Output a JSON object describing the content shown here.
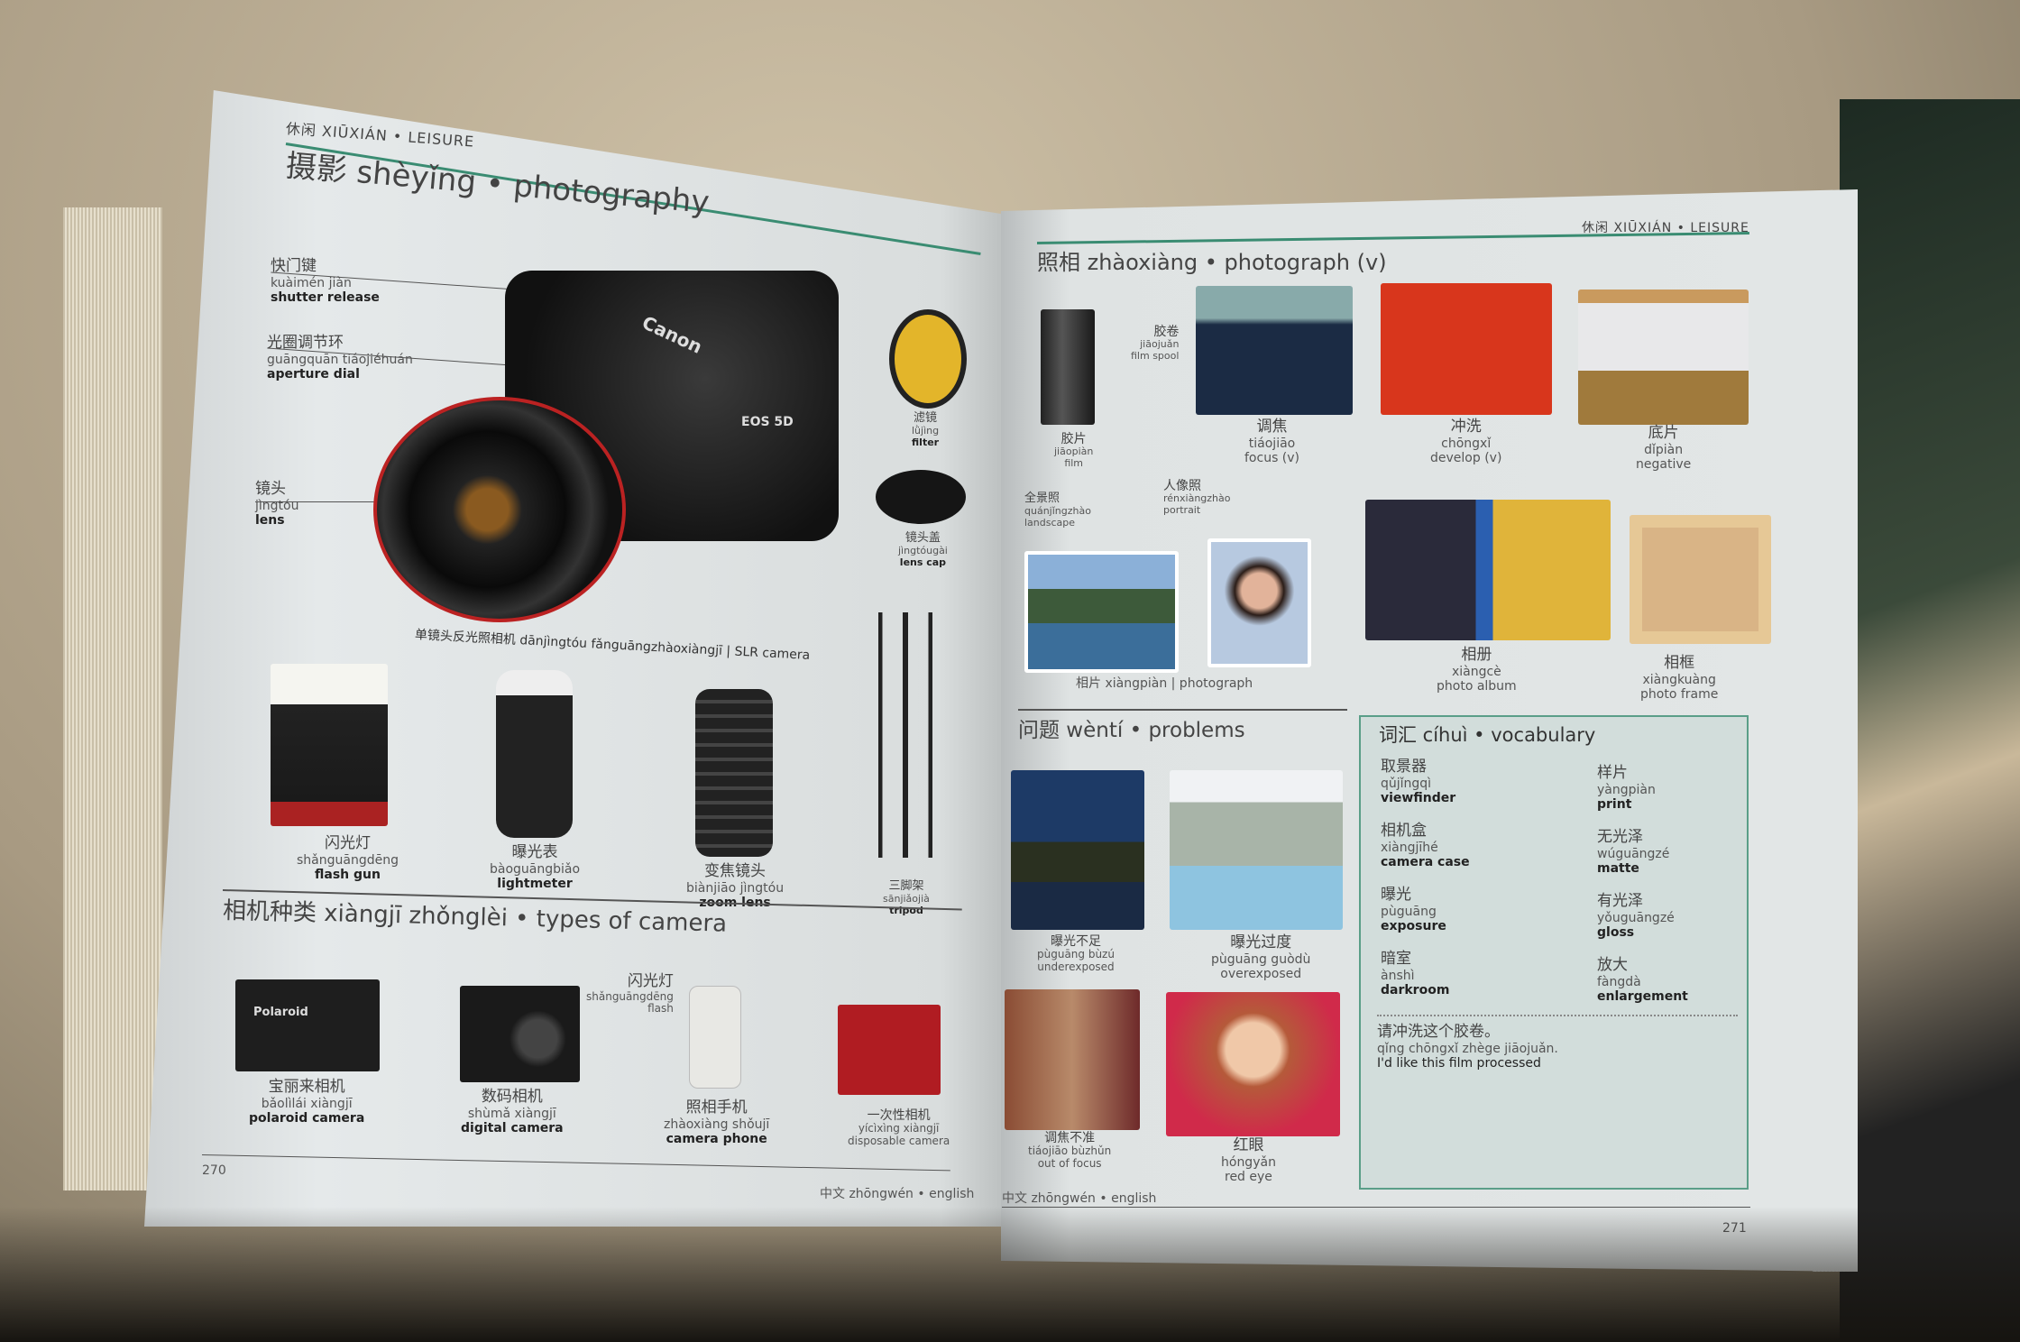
{
  "left_page": {
    "header": "休闲 XIŪXIÁN • LEISURE",
    "title": "摄影 shèyǐng • photography",
    "labels": [
      {
        "zh": "快门键",
        "py": "kuàimén jiàn",
        "en": "shutter release"
      },
      {
        "zh": "光圈调节环",
        "py": "guāngquān tiáojiéhuán",
        "en": "aperture dial"
      },
      {
        "zh": "镜头",
        "py": "jìngtóu",
        "en": "lens"
      },
      {
        "zh": "滤镜",
        "py": "lǜjìng",
        "en": "filter"
      },
      {
        "zh": "镜头盖",
        "py": "jìngtóugài",
        "en": "lens cap"
      }
    ],
    "slr_caption": "单镜头反光照相机 dānjìngtóu fǎnguāngzhàoxiàngjī | SLR camera",
    "camera_brand": "Canon",
    "camera_model": "EOS 5D",
    "equipment": [
      {
        "zh": "闪光灯",
        "py": "shǎnguāngdēng",
        "en": "flash gun"
      },
      {
        "zh": "曝光表",
        "py": "bàoguāngbiǎo",
        "en": "lightmeter"
      },
      {
        "zh": "变焦镜头",
        "py": "biànjiāo jìngtóu",
        "en": "zoom lens"
      },
      {
        "zh": "三脚架",
        "py": "sānjiǎojià",
        "en": "tripod"
      }
    ],
    "types_heading": "相机种类 xiàngjī zhǒnglèi • types of camera",
    "types": [
      {
        "zh": "宝丽来相机",
        "py": "bǎolìlái xiàngjī",
        "en": "polaroid camera"
      },
      {
        "zh": "数码相机",
        "py": "shùmǎ xiàngjī",
        "en": "digital camera"
      },
      {
        "zh": "照相手机",
        "py": "zhàoxiàng shǒujī",
        "en": "camera phone"
      },
      {
        "zh": "一次性相机",
        "py": "yícìxìng xiàngjī",
        "en": "disposable camera"
      }
    ],
    "flash": {
      "zh": "闪光灯",
      "py": "shǎnguāngdēng",
      "en": "flash"
    },
    "polaroid_brand": "Polaroid",
    "page_number": "270",
    "footer": "中文 zhōngwén • english"
  },
  "right_page": {
    "header": "休闲 XIŪXIÁN • LEISURE",
    "title": "照相 zhàoxiàng • photograph (v)",
    "items": [
      {
        "zh": "胶卷",
        "py": "jiāojuǎn",
        "en": "film spool"
      },
      {
        "zh": "胶片",
        "py": "jiāopiàn",
        "en": "film"
      },
      {
        "zh": "调焦",
        "py": "tiáojiāo",
        "en": "focus (v)"
      },
      {
        "zh": "冲洗",
        "py": "chōngxǐ",
        "en": "develop (v)"
      },
      {
        "zh": "底片",
        "py": "dǐpiàn",
        "en": "negative"
      },
      {
        "zh": "全景照",
        "py": "quánjǐngzhào",
        "en": "landscape"
      },
      {
        "zh": "人像照",
        "py": "rénxiàngzhào",
        "en": "portrait"
      },
      {
        "zh": "相册",
        "py": "xiàngcè",
        "en": "photo album"
      },
      {
        "zh": "相框",
        "py": "xiàngkuàng",
        "en": "photo frame"
      }
    ],
    "photograph_caption": "相片 xiàngpiàn | photograph",
    "problems_heading": "问题 wèntí • problems",
    "problems": [
      {
        "zh": "曝光不足",
        "py": "pùguāng bùzú",
        "en": "underexposed"
      },
      {
        "zh": "曝光过度",
        "py": "pùguāng guòdù",
        "en": "overexposed"
      },
      {
        "zh": "调焦不准",
        "py": "tiáojiāo bùzhǔn",
        "en": "out of focus"
      },
      {
        "zh": "红眼",
        "py": "hóngyǎn",
        "en": "red eye"
      }
    ],
    "vocabulary": {
      "heading": "词汇 cíhuì • vocabulary",
      "left": [
        {
          "zh": "取景器",
          "py": "qǔjǐngqì",
          "en": "viewfinder"
        },
        {
          "zh": "相机盒",
          "py": "xiàngjīhé",
          "en": "camera case"
        },
        {
          "zh": "曝光",
          "py": "pùguāng",
          "en": "exposure"
        },
        {
          "zh": "暗室",
          "py": "ànshì",
          "en": "darkroom"
        }
      ],
      "right": [
        {
          "zh": "样片",
          "py": "yàngpiàn",
          "en": "print"
        },
        {
          "zh": "无光泽",
          "py": "wúguāngzé",
          "en": "matte"
        },
        {
          "zh": "有光泽",
          "py": "yǒuguāngzé",
          "en": "gloss"
        },
        {
          "zh": "放大",
          "py": "fàngdà",
          "en": "enlargement"
        }
      ],
      "phrase": {
        "zh": "请冲洗这个胶卷。",
        "py": "qǐng chōngxǐ zhège jiāojuǎn.",
        "en": "I'd like this film processed"
      }
    },
    "footer": "中文 zhōngwén • english",
    "page_number": "271"
  }
}
